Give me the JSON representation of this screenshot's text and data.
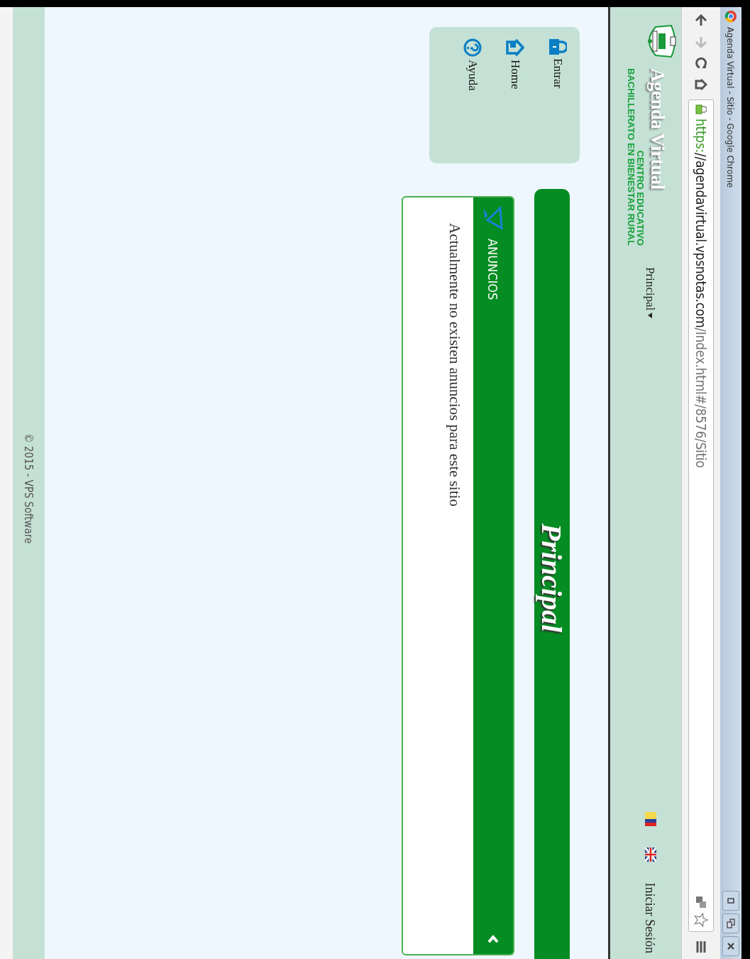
{
  "browser": {
    "title": "Agenda Virtual - Sitio - Google Chrome",
    "url": {
      "scheme": "https:",
      "host": "//agendavirtual.vpsnotas.com",
      "path": "/Index.html#/8576/Sitio"
    }
  },
  "header": {
    "title": "Agenda Virtual",
    "subtitle_lines": [
      "CENTRO EDUCATIVO",
      "BACHILLERATO EN BIENESTAR RURAL"
    ],
    "nav_menu": "Principal",
    "login": "Iniciar Sesión"
  },
  "sidebar": {
    "items": [
      {
        "label": "Entrar",
        "kind": "lock"
      },
      {
        "label": "Home",
        "kind": "home"
      },
      {
        "label": "Ayuda",
        "kind": "help"
      }
    ]
  },
  "banner": {
    "title": "Principal"
  },
  "announcements": {
    "title": "ANUNCIOS",
    "message": "Actualmente no existen anuncios para este sitio"
  },
  "footer": {
    "text": "© 2015 - VPS Software"
  }
}
